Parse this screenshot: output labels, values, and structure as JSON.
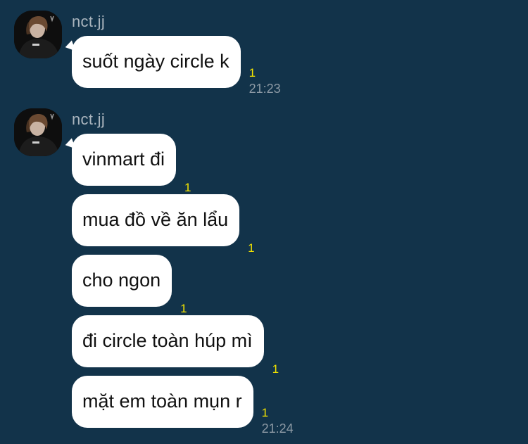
{
  "colors": {
    "background": "#12334a",
    "bubble": "#ffffff",
    "read_count": "#f2e300",
    "timestamp": "#8d9aa5",
    "sender_name": "#a9b4bd"
  },
  "groups": [
    {
      "sender": "nct.jj",
      "avatar_icon": "profile-avatar",
      "messages": [
        {
          "text": "suốt ngày circle k",
          "read": "1",
          "time": "21:23"
        }
      ]
    },
    {
      "sender": "nct.jj",
      "avatar_icon": "profile-avatar",
      "messages": [
        {
          "text": "vinmart đi",
          "read": "1",
          "time": ""
        },
        {
          "text": "mua đồ về ăn lẩu",
          "read": "1",
          "time": ""
        },
        {
          "text": "cho ngon",
          "read": "1",
          "time": ""
        },
        {
          "text": "đi circle toàn húp mì",
          "read": "1",
          "time": ""
        },
        {
          "text": "mặt em toàn mụn r",
          "read": "1",
          "time": "21:24"
        }
      ]
    }
  ]
}
